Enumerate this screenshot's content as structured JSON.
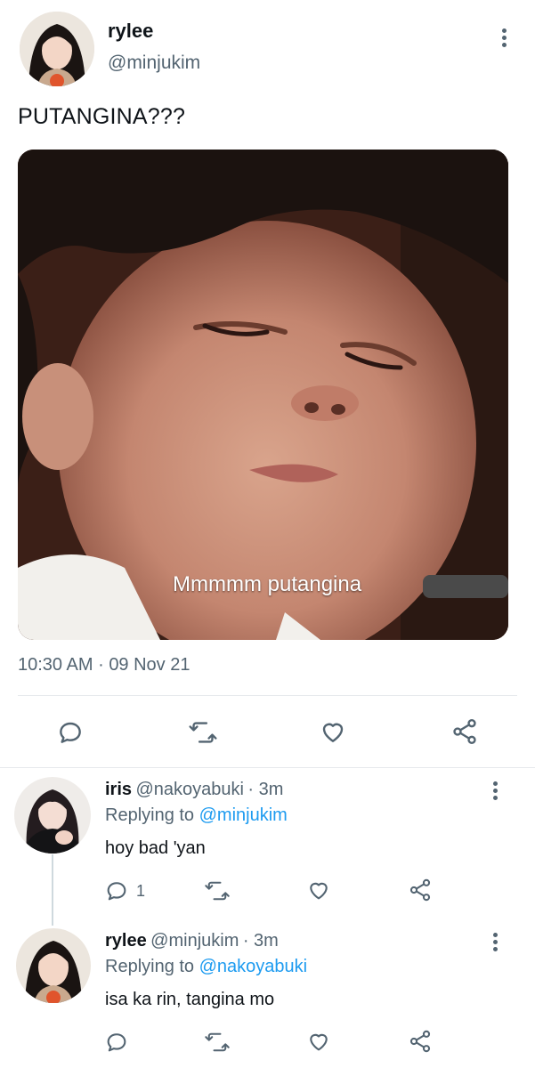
{
  "tweet": {
    "author_name": "rylee",
    "author_handle": "@minjukim",
    "text": "PUTANGINA???",
    "media_caption": "Mmmmm putangina",
    "time": "10:30 AM",
    "separator": "·",
    "date": "09 Nov 21"
  },
  "actions": {
    "icons": [
      "reply-icon",
      "retweet-icon",
      "like-icon",
      "share-icon"
    ]
  },
  "replies": [
    {
      "name": "iris",
      "handle": "@nakoyabuki",
      "age": "· 3m",
      "replying_prefix": "Replying to",
      "replying_to": "@minjukim",
      "text": "hoy bad 'yan",
      "reply_count": "1"
    },
    {
      "name": "rylee",
      "handle": "@minjukim",
      "age": "· 3m",
      "replying_prefix": "Replying to",
      "replying_to": "@nakoyabuki",
      "text": "isa ka rin, tangina mo",
      "reply_count": ""
    }
  ],
  "colors": {
    "accent": "#1d9bf0",
    "muted": "#536471",
    "text": "#0f1419",
    "divider": "#e6e9ec"
  }
}
